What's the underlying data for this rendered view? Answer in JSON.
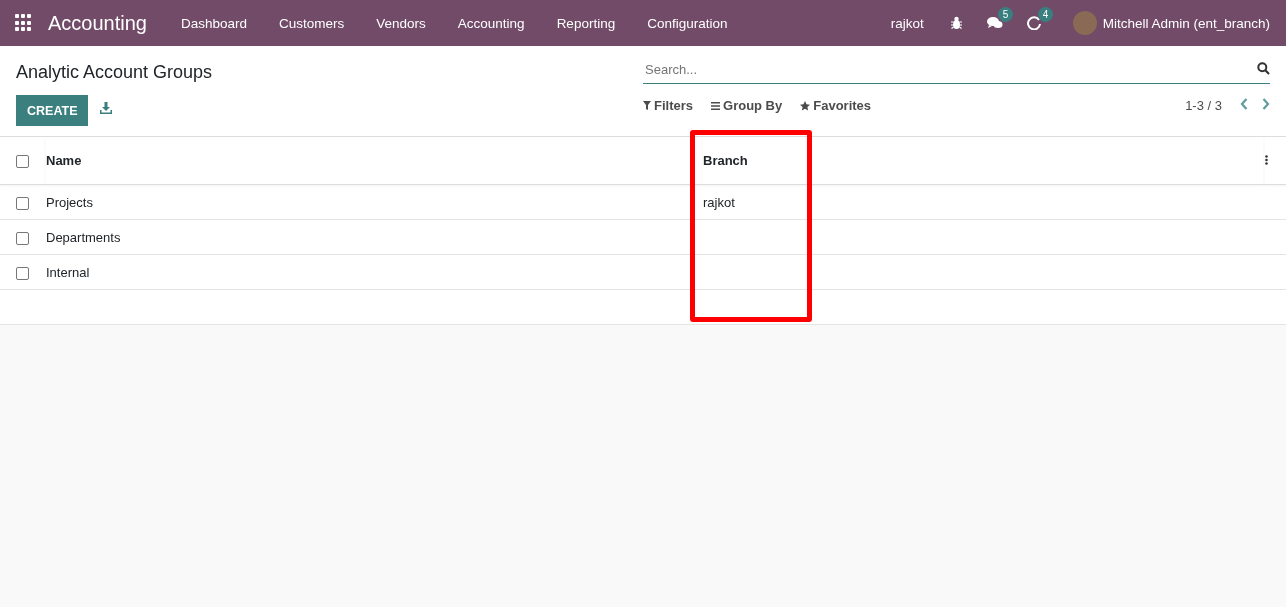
{
  "navbar": {
    "app_name": "Accounting",
    "menu": [
      "Dashboard",
      "Customers",
      "Vendors",
      "Accounting",
      "Reporting",
      "Configuration"
    ],
    "branch": "rajkot",
    "messages_count": "5",
    "activities_count": "4",
    "user": "Mitchell Admin (ent_branch)"
  },
  "control_panel": {
    "title": "Analytic Account Groups",
    "create_button": "CREATE",
    "search": {
      "placeholder": "Search..."
    },
    "filters": [
      "Filters",
      "Group By",
      "Favorites"
    ],
    "pager": "1-3 / 3"
  },
  "table": {
    "columns": [
      "Name",
      "Branch"
    ],
    "rows": [
      {
        "name": "Projects",
        "branch": "rajkot",
        "checked": false
      },
      {
        "name": "Departments",
        "branch": "",
        "checked": false
      },
      {
        "name": "Internal",
        "branch": "",
        "checked": false
      }
    ],
    "all_checked": false
  }
}
